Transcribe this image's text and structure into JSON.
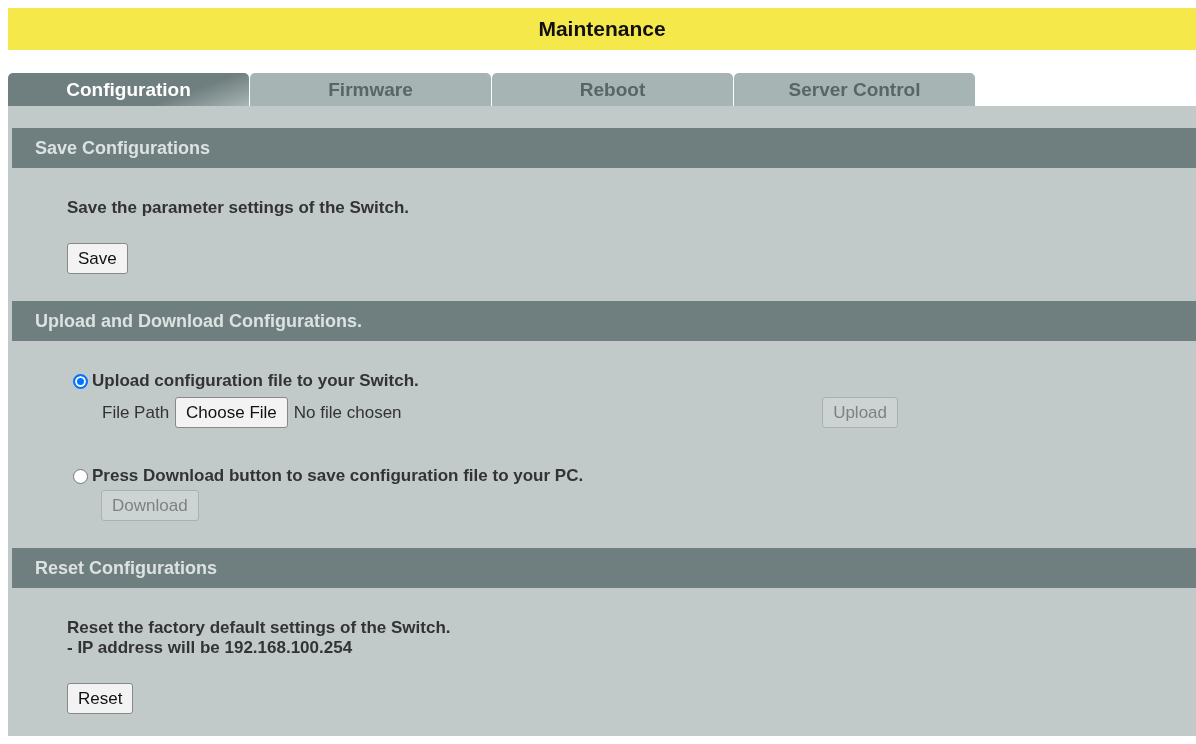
{
  "title": "Maintenance",
  "tabs": [
    {
      "label": "Configuration",
      "selected": true
    },
    {
      "label": "Firmware",
      "selected": false
    },
    {
      "label": "Reboot",
      "selected": false
    },
    {
      "label": "Server Control",
      "selected": false
    }
  ],
  "sections": [
    {
      "heading": "Save Configurations",
      "items": [
        {
          "kind": "text",
          "lines": [
            "Save the parameter settings of the Switch."
          ]
        },
        {
          "kind": "button",
          "label": "Save",
          "disabled": false
        }
      ]
    },
    {
      "heading": "Upload and Download Configurations.",
      "items": [
        {
          "kind": "radio",
          "label": "Upload configuration file to your Switch.",
          "selected": true
        },
        {
          "kind": "file",
          "label": "File Path",
          "button": "Choose File",
          "status": "No file chosen",
          "action": {
            "label": "Upload",
            "disabled": true
          }
        },
        {
          "kind": "radio",
          "label": "Press Download button to save configuration file to your PC.",
          "selected": false
        },
        {
          "kind": "button",
          "label": "Download",
          "disabled": true
        }
      ]
    },
    {
      "heading": "Reset Configurations",
      "items": [
        {
          "kind": "text",
          "lines": [
            "Reset the factory default settings of the Switch.",
            "- IP address will be 192.168.100.254"
          ]
        },
        {
          "kind": "button",
          "label": "Reset",
          "disabled": false
        }
      ]
    }
  ]
}
